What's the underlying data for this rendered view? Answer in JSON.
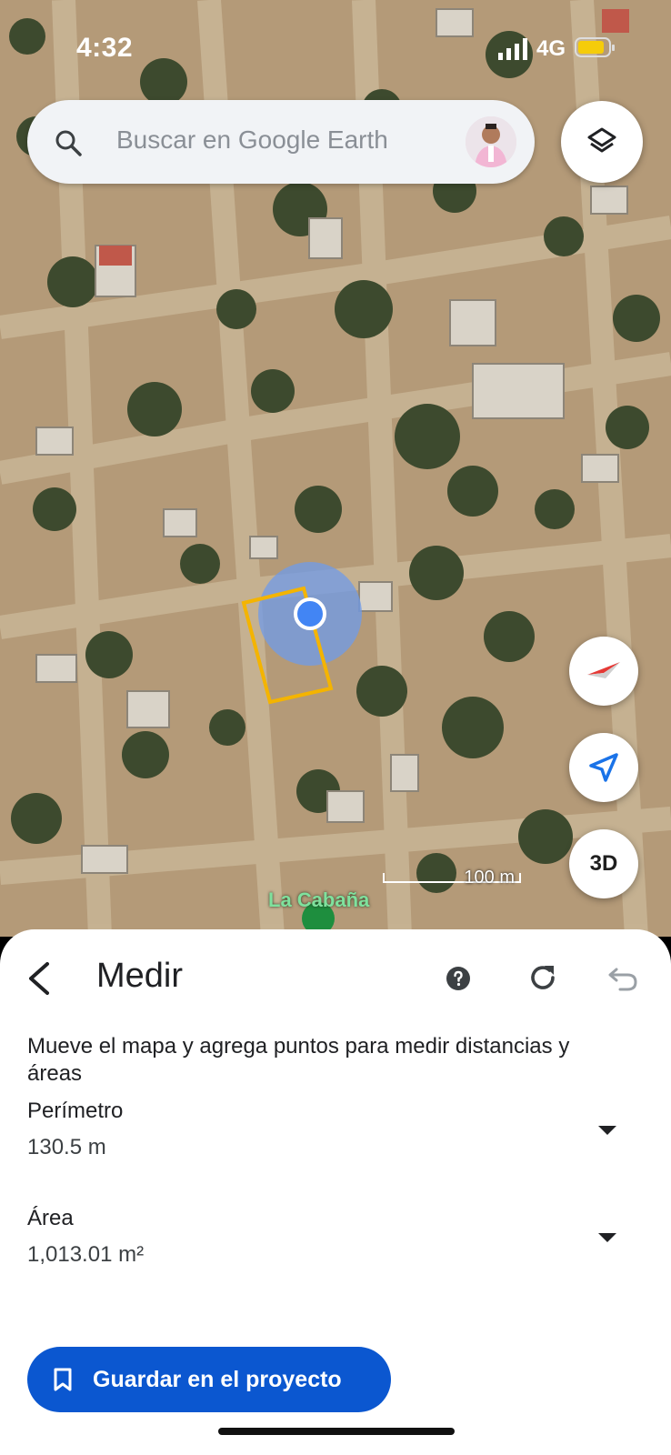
{
  "status_bar": {
    "time": "4:32",
    "network": "4G",
    "battery_color": "#f5cc0a"
  },
  "search": {
    "placeholder": "Buscar en Google Earth"
  },
  "map": {
    "place_label": "La Cabaña",
    "scale_label": "100 m",
    "measure_outline_color": "#f4b400",
    "location_color": "#4285f4"
  },
  "controls": {
    "three_d_label": "3D"
  },
  "panel": {
    "title": "Medir",
    "description": "Mueve el mapa y agrega puntos para medir distancias y áreas",
    "perimeter": {
      "label": "Perímetro",
      "value": "130.5 m"
    },
    "area": {
      "label": "Área",
      "value": "1,013.01 m²"
    },
    "save_label": "Guardar en el proyecto",
    "accent": "#0b57d0"
  }
}
